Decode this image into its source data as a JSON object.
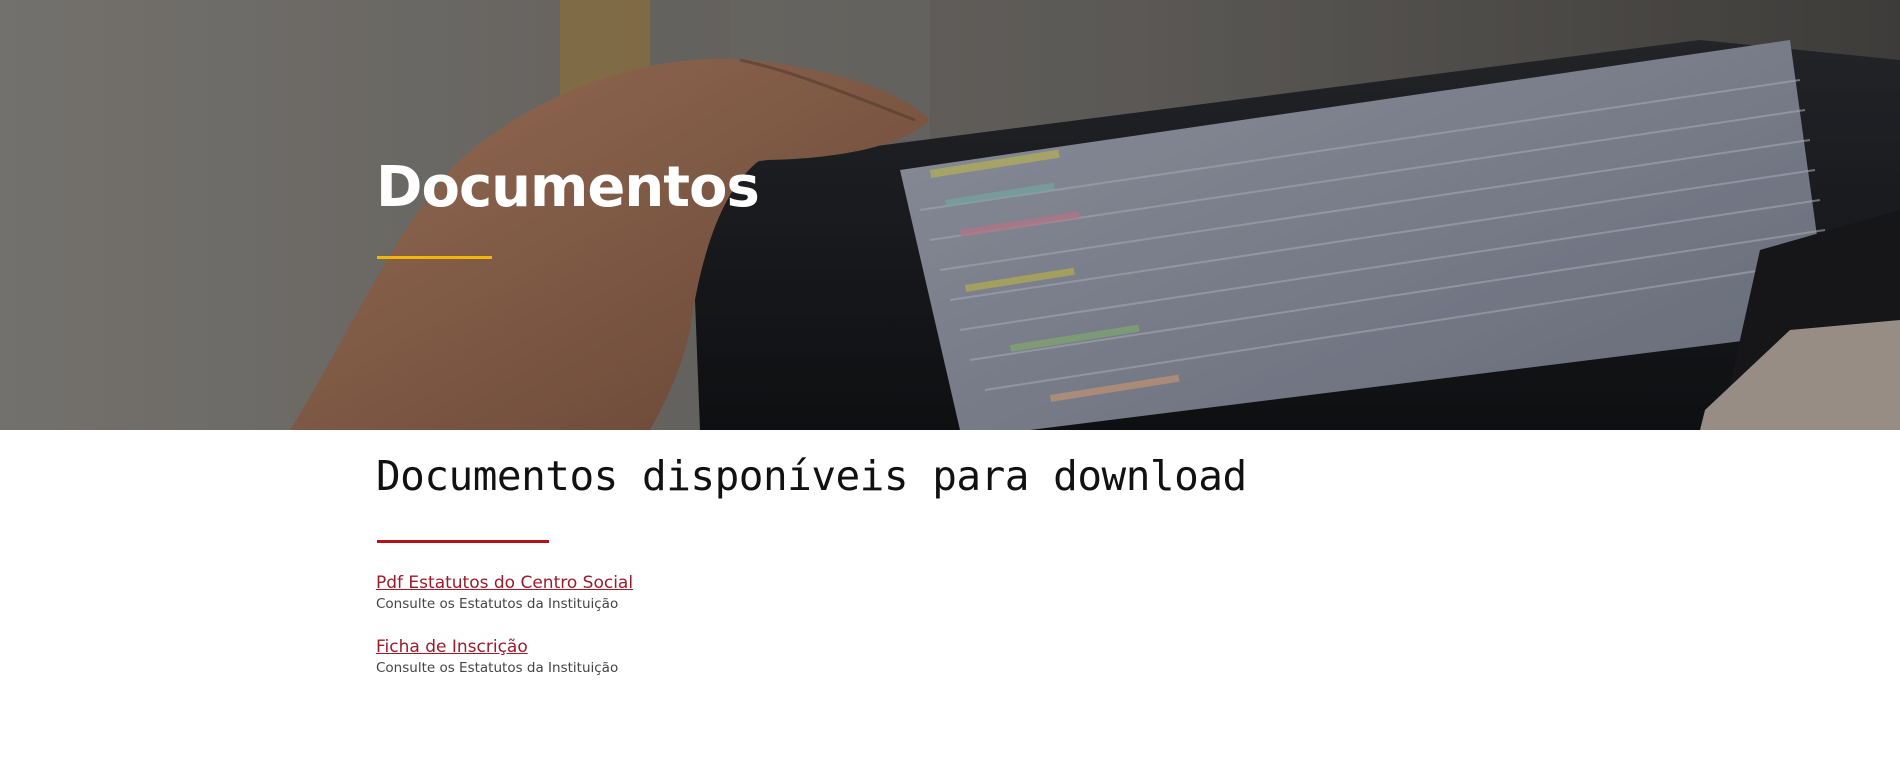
{
  "hero": {
    "title": "Documentos",
    "underline_color": "#f2b705",
    "background_image": "hand-pulling-folders-from-file-box-photo"
  },
  "main": {
    "section_title": "Documentos disponíveis para download",
    "underline_color": "#b3121b",
    "link_color": "#9b1b2a",
    "documents": [
      {
        "link_label": "Pdf Estatutos do Centro Social",
        "description": "Consulte os Estatutos da Instituição"
      },
      {
        "link_label": "Ficha de Inscrição",
        "description": "Consulte os Estatutos da Instituição"
      }
    ]
  }
}
